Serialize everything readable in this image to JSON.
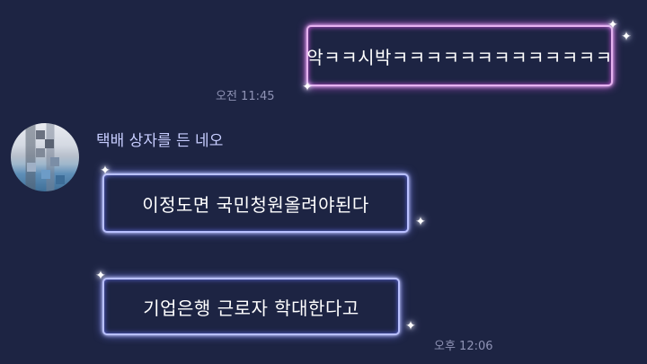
{
  "messages": [
    {
      "id": "m1",
      "side": "right",
      "text": "악ㅋㅋ시박ㅋㅋㅋㅋㅋㅋㅋㅋㅋㅋㅋㅋㅋ",
      "time": "오전 11:45"
    },
    {
      "id": "m2",
      "side": "left",
      "text": "이정도면 국민청원올려야된다"
    },
    {
      "id": "m3",
      "side": "left",
      "text": "기업은행 근로자 학대한다고",
      "time": "오후 12:06"
    }
  ],
  "sender": {
    "name": "택배 상자를 든 네오"
  },
  "colors": {
    "background": "#1d2443",
    "pink_glow": "#d55fe6",
    "blue_glow": "#6f79ea",
    "time_text": "#8f93b5",
    "name_text": "#c7cdff"
  }
}
